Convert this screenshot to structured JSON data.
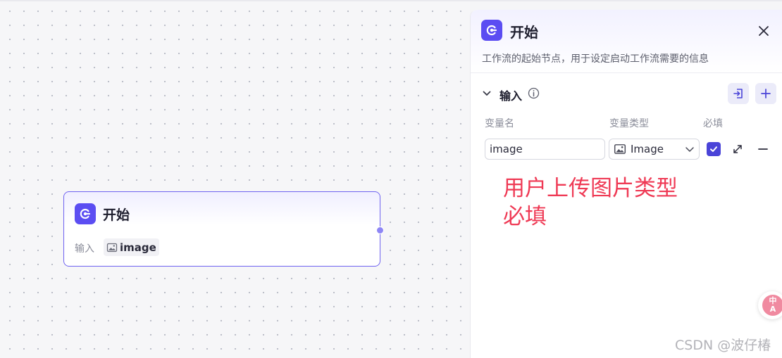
{
  "node": {
    "title": "开始",
    "input_label": "输入",
    "input_chip": "image",
    "icon": "start-node-icon"
  },
  "panel": {
    "title": "开始",
    "description": "工作流的起始节点，用于设定启动工作流需要的信息",
    "section_title": "输入",
    "columns": {
      "name": "变量名",
      "type": "变量类型",
      "required": "必填"
    },
    "variable": {
      "name_value": "image",
      "type_value": "Image",
      "required": true
    },
    "icons": [
      "close-icon",
      "chevron-down-icon",
      "info-icon",
      "import-icon",
      "plus-icon",
      "image-icon",
      "expand-icon",
      "minus-icon"
    ]
  },
  "annotation": "用户上传图片类型\n必填",
  "fab": {
    "label": "中\nA"
  },
  "watermark": "CSDN @波仔椿",
  "colors": {
    "accent": "#5b4df2",
    "node_border": "#6f63f0",
    "annotation": "#ef3a55",
    "checkbox": "#4a44d8"
  }
}
